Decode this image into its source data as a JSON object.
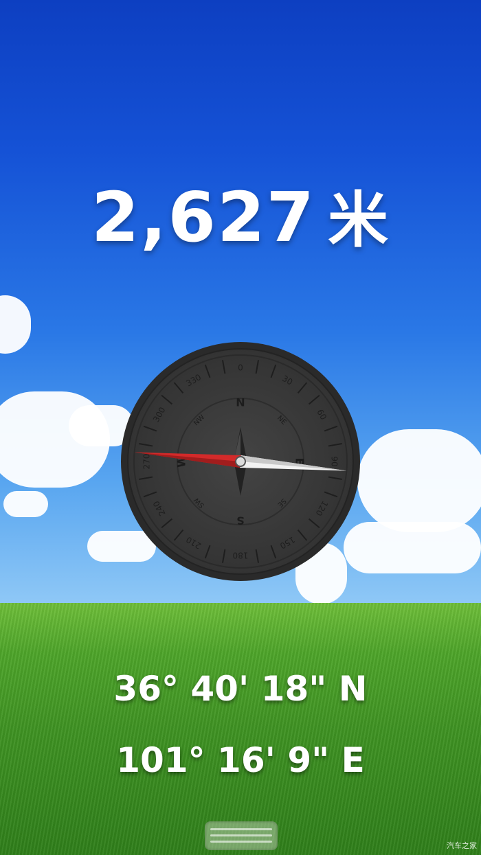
{
  "altitude": {
    "value": "2,627",
    "unit": "米"
  },
  "compass": {
    "degree_labels": [
      "0",
      "30",
      "60",
      "90",
      "120",
      "150",
      "180",
      "210",
      "240",
      "270",
      "300",
      "330"
    ],
    "cardinals": [
      "N",
      "E",
      "S",
      "W"
    ],
    "intercardinals": [
      "NE",
      "SE",
      "SW",
      "NW"
    ],
    "heading_deg": 275,
    "colors": {
      "face": "#3a3a3a",
      "rim": "#2c2c2c",
      "needle_north": "#d32a2a",
      "needle_south": "#f2f2f2"
    }
  },
  "coordinates": {
    "latitude": "36° 40' 18\" N",
    "longitude": "101° 16' 9\" E"
  },
  "watermark": "汽车之家"
}
